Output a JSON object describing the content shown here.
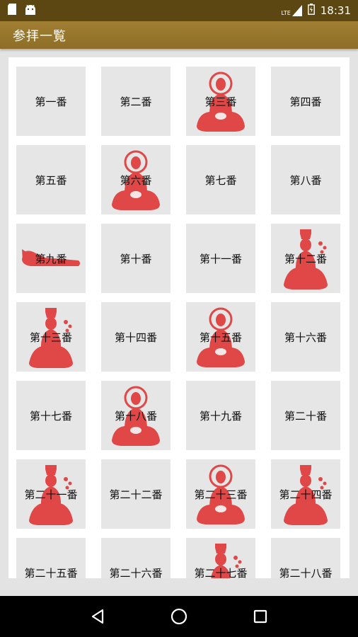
{
  "status_bar": {
    "network_label": "LTE",
    "time": "18:31"
  },
  "app_bar": {
    "title": "参拝一覧"
  },
  "colors": {
    "accent": "#9a7a2f",
    "buddha_red": "#e04848",
    "tile_bg": "#e6e6e6"
  },
  "tiles": [
    {
      "label": "第一番",
      "figure": "none"
    },
    {
      "label": "第二番",
      "figure": "none"
    },
    {
      "label": "第三番",
      "figure": "seated-buddha-icon"
    },
    {
      "label": "第四番",
      "figure": "none"
    },
    {
      "label": "第五番",
      "figure": "none"
    },
    {
      "label": "第六番",
      "figure": "seated-buddha-icon"
    },
    {
      "label": "第七番",
      "figure": "none"
    },
    {
      "label": "第八番",
      "figure": "none"
    },
    {
      "label": "第九番",
      "figure": "reclining-buddha-icon"
    },
    {
      "label": "第十番",
      "figure": "none"
    },
    {
      "label": "第十一番",
      "figure": "none"
    },
    {
      "label": "第十二番",
      "figure": "crowned-buddha-icon"
    },
    {
      "label": "第十三番",
      "figure": "crowned-buddha-icon"
    },
    {
      "label": "第十四番",
      "figure": "none"
    },
    {
      "label": "第十五番",
      "figure": "seated-buddha-icon"
    },
    {
      "label": "第十六番",
      "figure": "none"
    },
    {
      "label": "第十七番",
      "figure": "none"
    },
    {
      "label": "第十八番",
      "figure": "seated-buddha-icon"
    },
    {
      "label": "第十九番",
      "figure": "none"
    },
    {
      "label": "第二十番",
      "figure": "none"
    },
    {
      "label": "第二十一番",
      "figure": "crowned-buddha-icon"
    },
    {
      "label": "第二十二番",
      "figure": "none"
    },
    {
      "label": "第二十三番",
      "figure": "seated-buddha-icon"
    },
    {
      "label": "第二十四番",
      "figure": "crowned-buddha-icon"
    },
    {
      "label": "第二十五番",
      "figure": "none"
    },
    {
      "label": "第二十六番",
      "figure": "none"
    },
    {
      "label": "第二十七番",
      "figure": "crowned-buddha-icon"
    },
    {
      "label": "第二十八番",
      "figure": "none"
    }
  ]
}
